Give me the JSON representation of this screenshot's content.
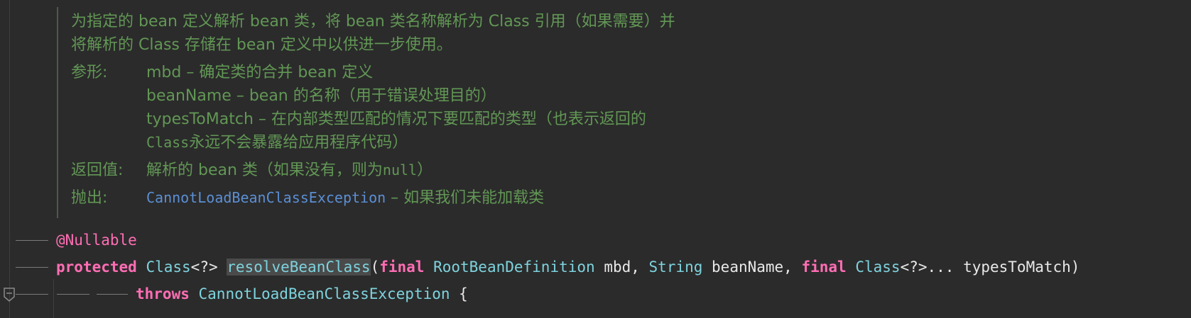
{
  "javadoc": {
    "description_line1": "为指定的 bean 定义解析 bean 类，将 bean 类名称解析为 Class 引用（如果需要）并",
    "description_line2": "将解析的 Class 存储在 bean 定义中以供进一步使用。",
    "params_label": "参形:",
    "params": [
      "mbd – 确定类的合并 bean 定义",
      "beanName – bean 的名称（用于错误处理目的）",
      "typesToMatch – 在内部类型匹配的情况下要匹配的类型（也表示返回的"
    ],
    "param_continuation_code": "Class",
    "param_continuation_text": "永远不会暴露给应用程序代码）",
    "returns_label": "返回值:",
    "returns_text": "解析的 bean 类（如果没有，则为",
    "returns_code": "null",
    "returns_close": "）",
    "throws_label": "抛出:",
    "throws_link": "CannotLoadBeanClassException",
    "throws_text": " – 如果我们未能加载类"
  },
  "code": {
    "annotation": "@Nullable",
    "modifier": "protected",
    "return_type": "Class",
    "return_generic": "<?>",
    "method_name": "resolveBeanClass",
    "open_paren": "(",
    "final_kw_1": "final",
    "param1_type": "RootBeanDefinition",
    "param1_name": " mbd, ",
    "param2_type": "String",
    "param2_name": " beanName, ",
    "final_kw_2": "final",
    "param3_type": "Class",
    "param3_rest": "<?>... typesToMatch)",
    "throws_kw": "throws",
    "exception_type": "CannotLoadBeanClassException",
    "open_brace": " {"
  },
  "colors": {
    "background": "#2b2b2b",
    "doc_text": "#629755",
    "doc_link": "#5b8fd5",
    "keyword": "#ff6eb4",
    "type": "#7ed3de",
    "plain": "#e8e8e8"
  },
  "icons": {
    "fold": "fold-marker-icon"
  }
}
